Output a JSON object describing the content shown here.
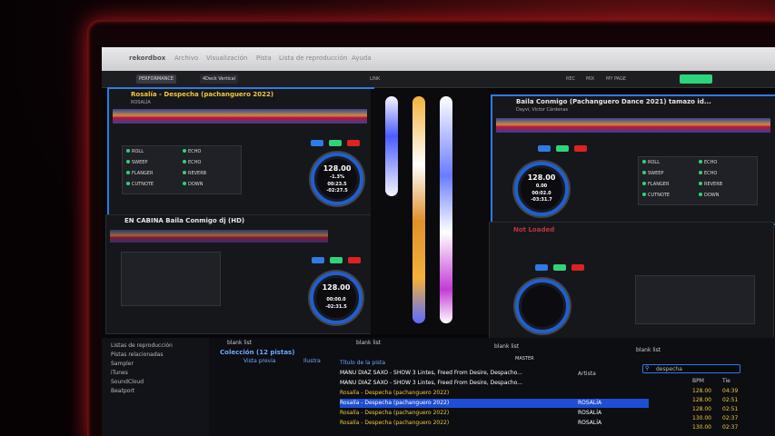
{
  "app": {
    "title": "rekordbox",
    "menu": [
      "Archivo",
      "Visualización",
      "Pista",
      "Lista de reproducción",
      "Ayuda"
    ]
  },
  "toolbar": {
    "mode": "PERFORMANCE",
    "layout": "4Deck Vertical",
    "link": "LINK",
    "right_buttons": [
      "REC",
      "MIX",
      "MY PAGE"
    ]
  },
  "deck1": {
    "title": "Rosalía - Despecha (pachanguero 2022)",
    "artist": "ROSALÍA",
    "bpm": "128.00",
    "pitch": "-1.3%",
    "time_elapsed": "00:23.5",
    "time_remain": "-02:27.5",
    "fx": [
      "ROLL",
      "SWEEP",
      "FLANGER",
      "CUTNOTE",
      "ECHO",
      "ECHO",
      "REVERB",
      "DOWN"
    ],
    "deck_num": "1"
  },
  "deck2": {
    "title": "Baila Conmigo (Pachanguero Dance 2021) tamazo id...",
    "artist": "Dayvi, Victor Cárdenas",
    "bpm": "128.00",
    "pitch": "0.00",
    "time_elapsed": "00:02.0",
    "time_remain": "-03:31.7",
    "fx": [
      "ROLL",
      "SWEEP",
      "FLANGER",
      "CUTNOTE",
      "ECHO",
      "ECHO",
      "REVERB",
      "DOWN"
    ],
    "deck_num": "2"
  },
  "deck3": {
    "title": "EN CABINA Baila Conmigo dj (HD)",
    "artist": "",
    "bpm": "128.00",
    "time_elapsed": "00:00.0",
    "time_remain": "-02:31.5",
    "deck_num": "3"
  },
  "deck4": {
    "title": "Not Loaded",
    "deck_num": "4"
  },
  "browser": {
    "tree": [
      "Listas de reproducción",
      "Pistas relacionadas",
      "Sampler",
      "iTunes",
      "SoundCloud",
      "Beatport"
    ],
    "collection_label": "Colección (12 pistas)",
    "blank_list": "blank list",
    "columns": {
      "preview": "Vista previa",
      "artwork": "Ilustra",
      "title": "Título de la pista",
      "artist": "Artista",
      "bpm": "BPM",
      "time": "Tie"
    },
    "search_value": "despecha",
    "master": "MASTER",
    "rows": [
      {
        "title": "MANU DIAZ SAXO - SHOW 3 Lintes, Freed From Desire, Despacho...",
        "artist": "",
        "bpm": "128.00",
        "time": "04:39"
      },
      {
        "title": "MANU DIAZ SAXO - SHOW 3 Lintes, Freed From Desire, Despacho...",
        "artist": "",
        "bpm": "128.00",
        "time": "04:39"
      },
      {
        "title": "Rosalía - Despecha (pachanguero 2022)",
        "artist": "",
        "bpm": "128.00",
        "time": "02:51"
      },
      {
        "title": "Rosalía - Despecha (pachanguero 2022)",
        "artist": "ROSALÍA",
        "bpm": "128.00",
        "time": "02:51"
      },
      {
        "title": "Rosalía - Despecha (pachanguero 2022)",
        "artist": "ROSALÍA",
        "bpm": "130.00",
        "time": "02:37"
      },
      {
        "title": "Rosalía - Despecha (pachanguero 2022)",
        "artist": "ROSALÍA",
        "bpm": "130.00",
        "time": "02:37"
      }
    ]
  },
  "colors": {
    "accent": "#2f7be6",
    "highlight": "#1d4fd6",
    "track_text": "#f0c83a",
    "glow": "#b3161c"
  }
}
